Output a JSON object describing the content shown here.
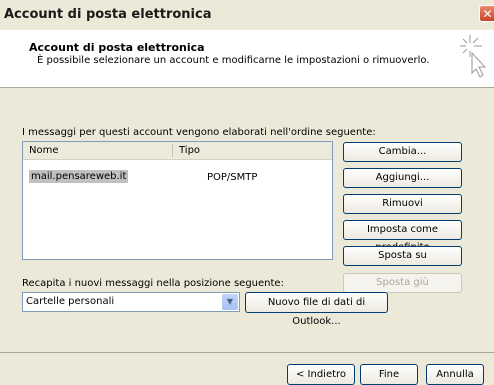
{
  "window": {
    "title": "Account di posta elettronica",
    "close_glyph": "✕"
  },
  "header": {
    "title": "Account di posta elettronica",
    "subtitle": "È possibile selezionare un account e modificarne le impostazioni o rimuoverlo.",
    "icon": "sparkle-cursor-icon"
  },
  "order_label": "I messaggi per questi account vengono elaborati nell'ordine seguente:",
  "accounts_list": {
    "columns": [
      "Nome",
      "Tipo"
    ],
    "rows": [
      {
        "name": "mail.pensareweb.it",
        "type": "POP/SMTP"
      }
    ]
  },
  "side_buttons": {
    "change": "Cambia...",
    "add": "Aggiungi...",
    "remove": "Rimuovi",
    "set_default": "Imposta come predefinito",
    "move_up": "Sposta su",
    "move_down": "Sposta giù"
  },
  "delivery": {
    "label": "Recapita i nuovi messaggi nella posizione seguente:",
    "selected": "Cartelle personali",
    "new_file_button": "Nuovo file di dati di Outlook..."
  },
  "footer": {
    "back": "< Indietro",
    "finish": "Fine",
    "cancel": "Annulla"
  }
}
